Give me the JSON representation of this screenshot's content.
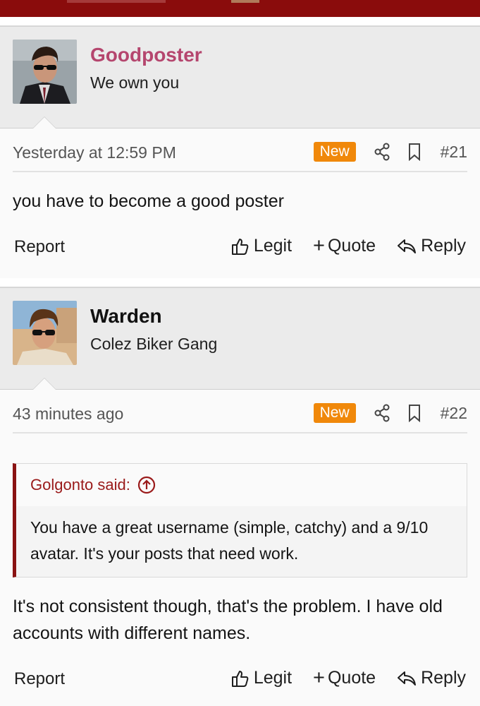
{
  "theme": {
    "brand": "#8a0c0c",
    "username_accent": "#b5466e",
    "badge": "#f0880a",
    "quote_accent": "#8a1313"
  },
  "posts": [
    {
      "username": "Goodposter",
      "user_title": "We own you",
      "date": "Yesterday at 12:59 PM",
      "badge": "New",
      "post_number": "#21",
      "body": "you have to become a good poster",
      "actions": {
        "report": "Report",
        "legit": "Legit",
        "quote": "Quote",
        "reply": "Reply"
      }
    },
    {
      "username": "Warden",
      "user_title": "Colez Biker Gang",
      "date": "43 minutes ago",
      "badge": "New",
      "post_number": "#22",
      "quote": {
        "attribution": "Golgonto said:",
        "text": "You have a great username (simple, catchy) and a 9/10 avatar. It's your posts that need work."
      },
      "body": "It's not consistent though, that's the problem. I have old accounts with different names.",
      "actions": {
        "report": "Report",
        "legit": "Legit",
        "quote": "Quote",
        "reply": "Reply"
      }
    }
  ]
}
